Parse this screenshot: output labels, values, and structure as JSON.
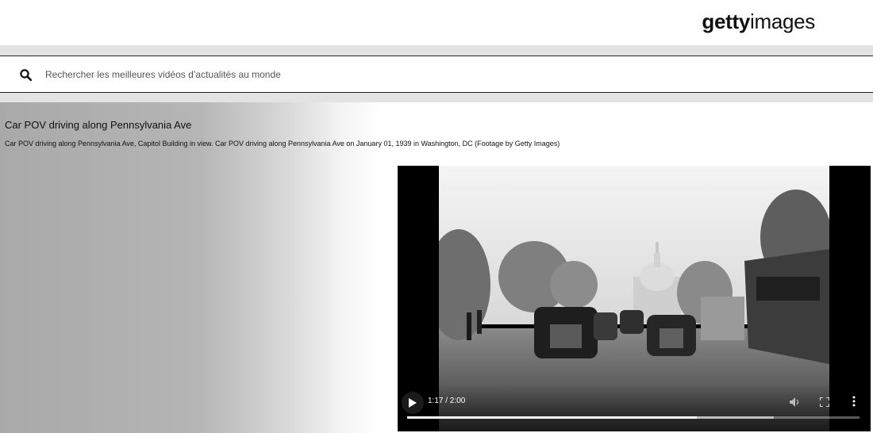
{
  "header": {
    "logo_bold": "getty",
    "logo_light": "images"
  },
  "search": {
    "placeholder": "Rechercher les meilleures vidéos d’actualités au monde",
    "icon": "search-icon"
  },
  "video": {
    "title": "Car POV driving along Pennsylvania Ave",
    "description": "Car POV driving along Pennsylvania Ave, Capitol Building in view. Car POV driving along Pennsylvania Ave on January 01, 1939 in Washington, DC (Footage by Getty Images)",
    "player": {
      "time_display": "1:17 / 2:00",
      "played_fraction": 0.64,
      "buffered_fraction": 0.81,
      "icons": [
        "play-icon",
        "volume-icon",
        "fullscreen-icon",
        "more-options-icon"
      ]
    }
  },
  "colors": {
    "player_bg": "#000000",
    "band": "#e3e3e3"
  }
}
